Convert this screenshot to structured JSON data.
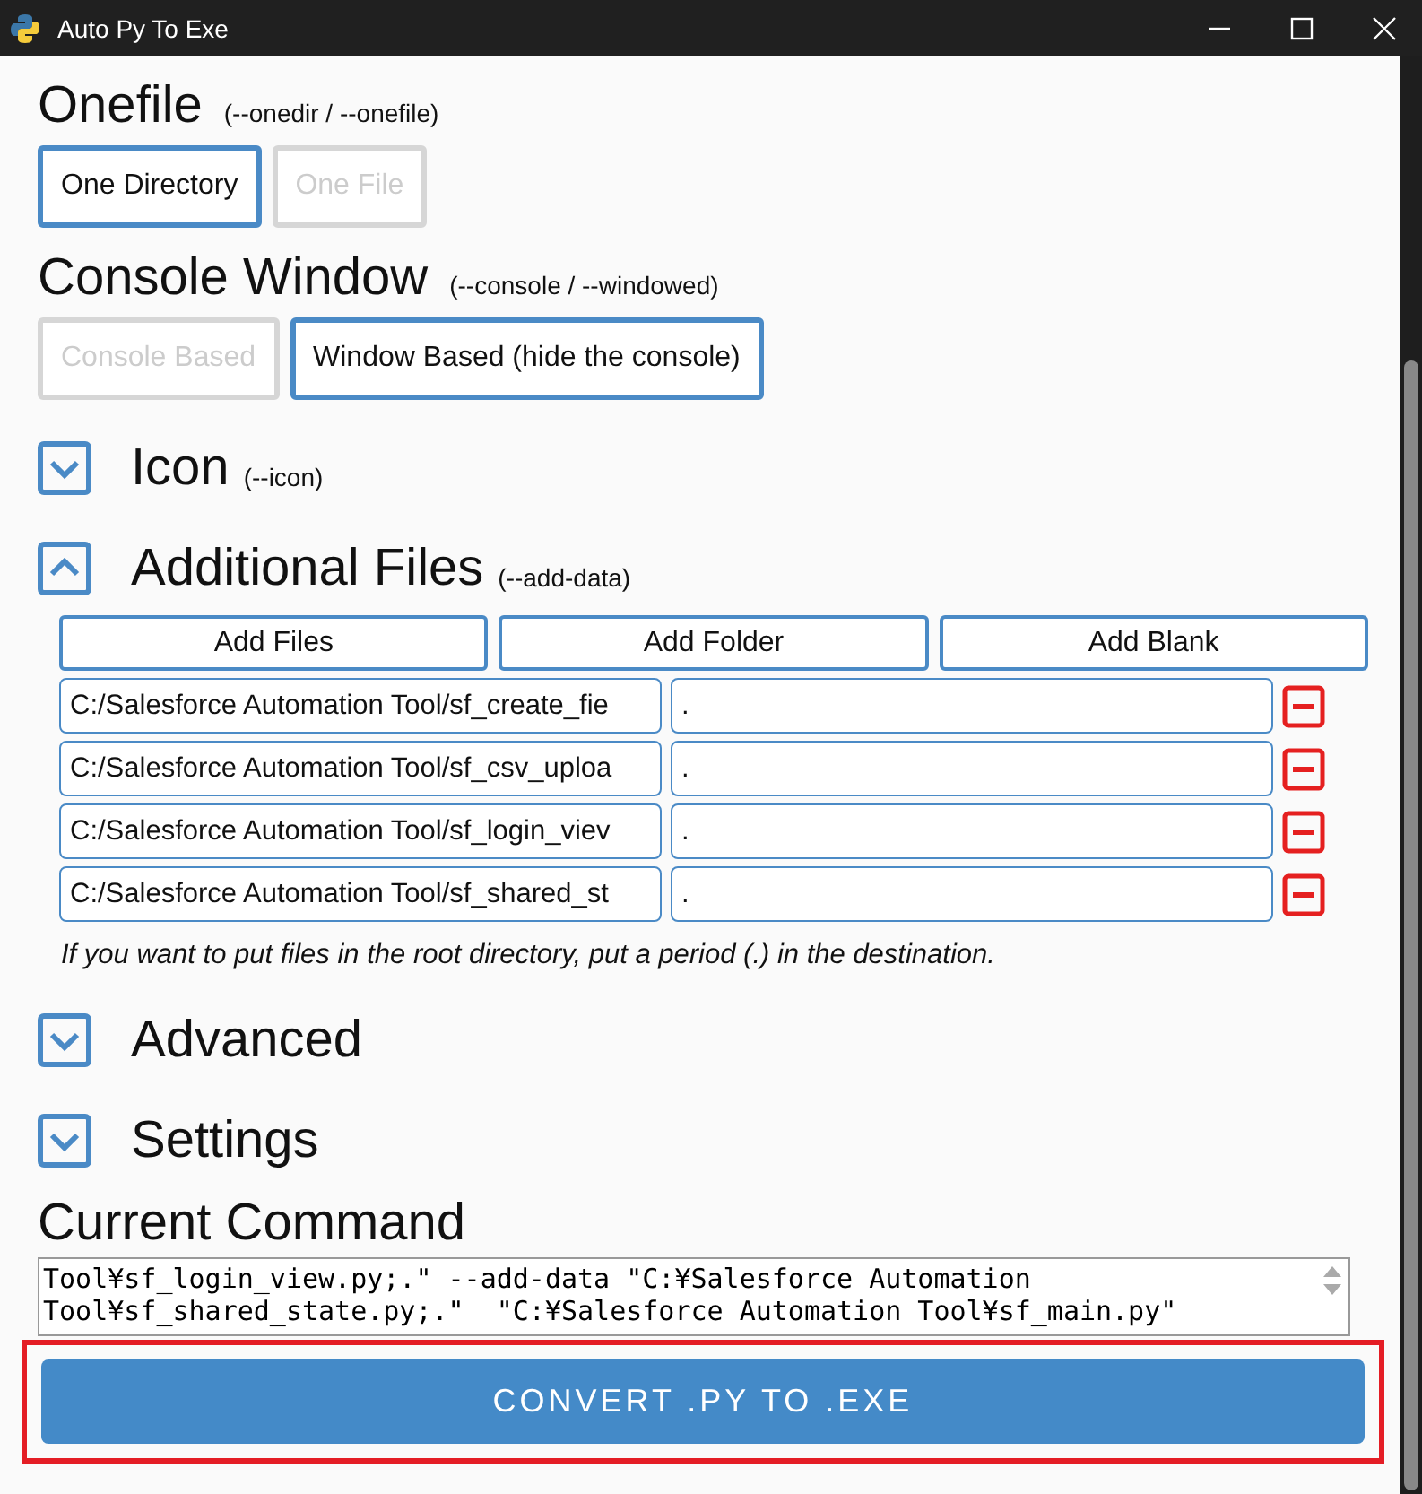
{
  "window": {
    "title": "Auto Py To Exe"
  },
  "onefile": {
    "title": "Onefile",
    "hint": "(--onedir / --onefile)",
    "options": [
      {
        "label": "One Directory",
        "selected": true
      },
      {
        "label": "One File",
        "selected": false
      }
    ]
  },
  "console_window": {
    "title": "Console Window",
    "hint": "(--console / --windowed)",
    "options": [
      {
        "label": "Console Based",
        "selected": false
      },
      {
        "label": "Window Based (hide the console)",
        "selected": true
      }
    ]
  },
  "icon_section": {
    "title": "Icon",
    "hint": "(--icon)",
    "expanded": false
  },
  "additional_files": {
    "title": "Additional Files",
    "hint": "(--add-data)",
    "expanded": true,
    "buttons": [
      "Add Files",
      "Add Folder",
      "Add Blank"
    ],
    "rows": [
      {
        "source": "C:/Salesforce Automation Tool/sf_create_fie",
        "destination": "."
      },
      {
        "source": "C:/Salesforce Automation Tool/sf_csv_uploa",
        "destination": "."
      },
      {
        "source": "C:/Salesforce Automation Tool/sf_login_viev",
        "destination": "."
      },
      {
        "source": "C:/Salesforce Automation Tool/sf_shared_st",
        "destination": "."
      }
    ],
    "note": "If you want to put files in the root directory, put a period (.) in the destination."
  },
  "sections": [
    {
      "title": "Advanced",
      "expanded": false
    },
    {
      "title": "Settings",
      "expanded": false
    }
  ],
  "current_command": {
    "title": "Current Command",
    "lines": [
      "Tool¥sf_login_view.py;.\" --add-data \"C:¥Salesforce Automation",
      "Tool¥sf_shared_state.py;.\"  \"C:¥Salesforce Automation Tool¥sf_main.py\""
    ]
  },
  "convert_button": {
    "label": "CONVERT .PY TO .EXE",
    "highlighted": true
  }
}
